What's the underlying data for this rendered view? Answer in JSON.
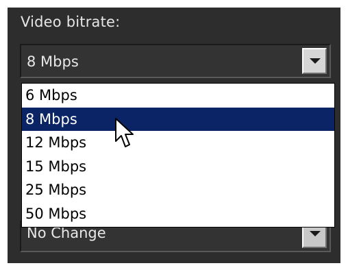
{
  "bitrate": {
    "label": "Video bitrate:",
    "selected_value": "8 Mbps",
    "options": [
      "6 Mbps",
      "8 Mbps",
      "12 Mbps",
      "15 Mbps",
      "25 Mbps",
      "50 Mbps"
    ],
    "highlighted_option": "8 Mbps"
  },
  "next_setting": {
    "selected_value": "No Change"
  },
  "icons": {
    "dropdown": "chevron-down-icon",
    "cursor": "mouse-pointer-icon"
  },
  "colors": {
    "panel_bg": "#2d2d2d",
    "highlight": "#0b2466"
  }
}
